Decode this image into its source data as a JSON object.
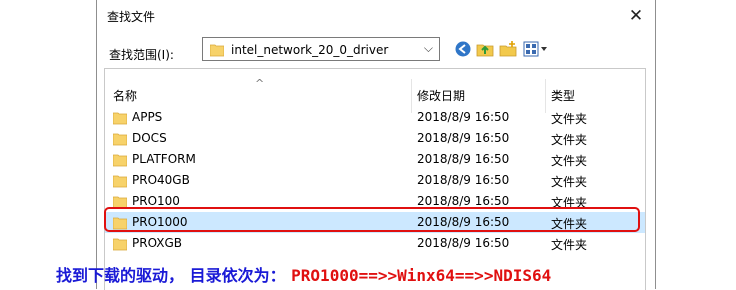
{
  "dialog": {
    "title": "查找文件",
    "close_glyph": "✕"
  },
  "toolbar": {
    "look_in_label": "查找范围(I):",
    "path": "intel_network_20_0_driver",
    "dropdown_glyph": "⌵",
    "icons": [
      "back-icon",
      "up-folder-icon",
      "new-folder-icon",
      "view-menu-icon"
    ]
  },
  "list": {
    "sort_glyph": "^",
    "columns": {
      "name": "名称",
      "modified": "修改日期",
      "type": "类型"
    },
    "rows": [
      {
        "name": "APPS",
        "modified": "2018/8/9 16:50",
        "type": "文件夹"
      },
      {
        "name": "DOCS",
        "modified": "2018/8/9 16:50",
        "type": "文件夹"
      },
      {
        "name": "PLATFORM",
        "modified": "2018/8/9 16:50",
        "type": "文件夹"
      },
      {
        "name": "PRO40GB",
        "modified": "2018/8/9 16:50",
        "type": "文件夹"
      },
      {
        "name": "PRO100",
        "modified": "2018/8/9 16:50",
        "type": "文件夹"
      },
      {
        "name": "PRO1000",
        "modified": "2018/8/9 16:50",
        "type": "文件夹",
        "selected": true
      },
      {
        "name": "PROXGB",
        "modified": "2018/8/9 16:50",
        "type": "文件夹"
      }
    ]
  },
  "annotation": {
    "text_prefix": "找到下载的驱动， 目录依次为：",
    "text_path": "PRO1000==>>Winx64==>>NDIS64"
  },
  "colors": {
    "selection": "#cce8ff",
    "highlight_border": "#e01010",
    "annotation_blue": "#1a1ad6",
    "folder_yellow": "#f7d26a"
  }
}
